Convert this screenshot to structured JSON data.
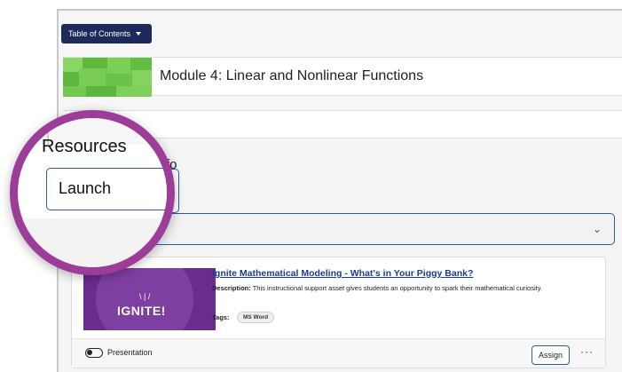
{
  "toc": {
    "label": "Table of Contents"
  },
  "module": {
    "title": "Module 4: Linear and Nonlinear Functions"
  },
  "partial_heading": "fo",
  "magnifier": {
    "resources_label": "Resources",
    "launch_label": "Launch"
  },
  "resource_card": {
    "title": "Ignite Mathematical Modeling - What's in Your Piggy Bank?",
    "description_label": "Description:",
    "description_text": " This instructional support asset gives students an opportunity to spark their mathematical curiosity.",
    "tags_label": "Tags:",
    "tags": [
      "MS Word"
    ],
    "thumbnail_text": "IGNITE!",
    "toggle_label": "Presentation",
    "assign_label": "Assign",
    "more_label": "···"
  },
  "icons": {
    "toc_caret": "caret-down-icon",
    "accordion": "chevron-down-icon",
    "more": "more-icon"
  },
  "colors": {
    "toc_bg": "#1f2a5c",
    "accent_border": "#2f5aa6",
    "link": "#1a3d8f",
    "magnifier_ring": "#9c3d97",
    "thumbnail_bg": "#6a2c8e",
    "module_thumb": "#6fc94b"
  }
}
